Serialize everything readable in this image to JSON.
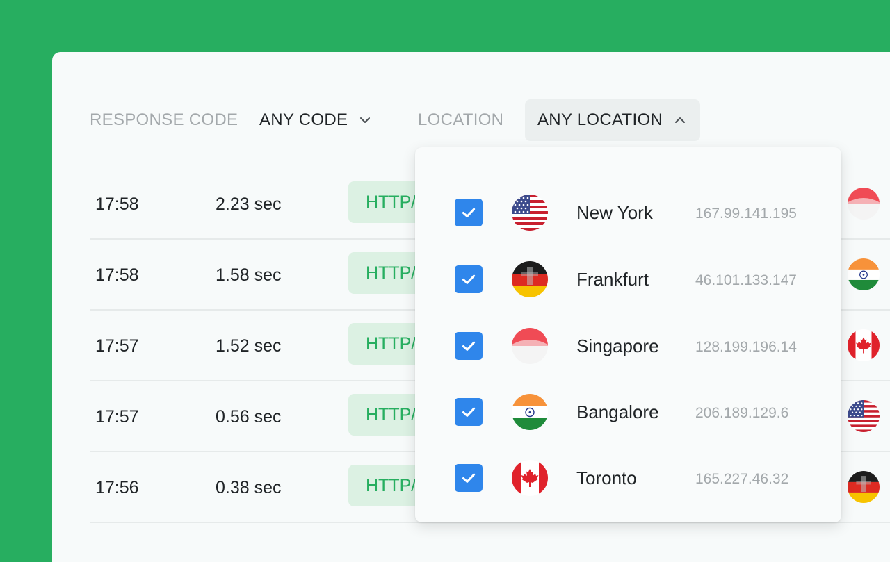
{
  "filters": {
    "response_code_label": "RESPONSE CODE",
    "response_code_value": "ANY CODE",
    "location_label": "LOCATION",
    "location_value": "ANY LOCATION"
  },
  "rows": [
    {
      "time": "17:58",
      "duration": "2.23 sec",
      "status": "HTTP/",
      "flag": "singapore-flag-icon"
    },
    {
      "time": "17:58",
      "duration": "1.58 sec",
      "status": "HTTP/",
      "flag": "india-flag-icon"
    },
    {
      "time": "17:57",
      "duration": "1.52 sec",
      "status": "HTTP/",
      "flag": "canada-flag-icon"
    },
    {
      "time": "17:57",
      "duration": "0.56 sec",
      "status": "HTTP/",
      "flag": "usa-flag-icon"
    },
    {
      "time": "17:56",
      "duration": "0.38 sec",
      "status": "HTTP/",
      "flag": "germany-flag-icon"
    }
  ],
  "locations": [
    {
      "city": "New York",
      "ip": "167.99.141.195",
      "checked": true,
      "flag": "usa-flag-icon"
    },
    {
      "city": "Frankfurt",
      "ip": "46.101.133.147",
      "checked": true,
      "flag": "germany-flag-icon"
    },
    {
      "city": "Singapore",
      "ip": "128.199.196.14",
      "checked": true,
      "flag": "singapore-flag-icon"
    },
    {
      "city": "Bangalore",
      "ip": "206.189.129.6",
      "checked": true,
      "flag": "india-flag-icon"
    },
    {
      "city": "Toronto",
      "ip": "165.227.46.32",
      "checked": true,
      "flag": "canada-flag-icon"
    }
  ],
  "colors": {
    "brand_green": "#27ae60",
    "status_bg": "#dcf1e3",
    "checkbox_blue": "#2f86eb"
  }
}
